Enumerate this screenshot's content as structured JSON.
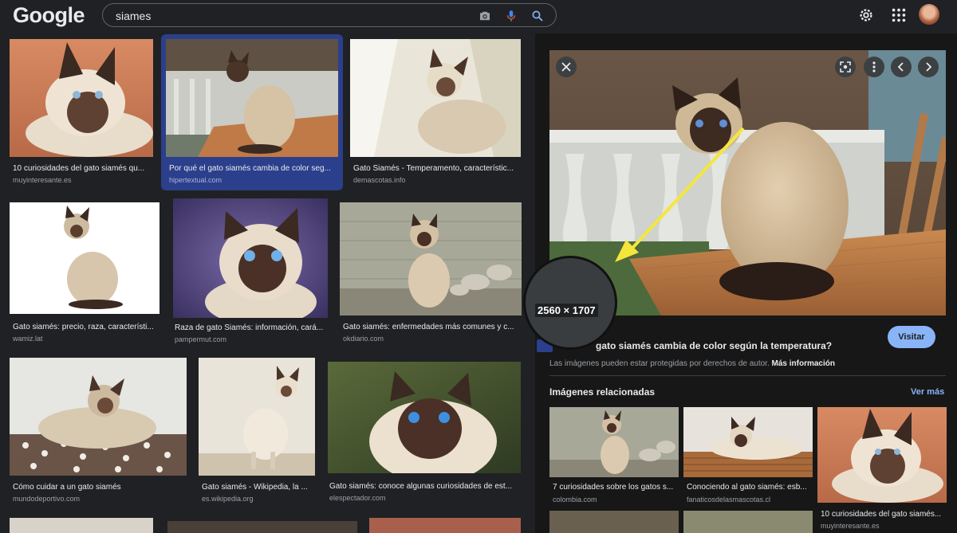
{
  "header": {
    "logo": "Google",
    "search_value": "siames",
    "icons": {
      "camera": "camera-icon",
      "mic": "mic-icon",
      "search": "search-icon",
      "settings": "gear-icon",
      "apps": "apps-grid-icon"
    },
    "accent": "#8ab4f8"
  },
  "results": [
    {
      "title": "10 curiosidades del gato siamés qu...",
      "source": "muyinteresante.es"
    },
    {
      "title": "Por qué el gato siamés cambia de color seg...",
      "source": "hipertextual.com"
    },
    {
      "title": "Gato Siamés - Temperamento, característic...",
      "source": "demascotas.info"
    },
    {
      "title": "Gato siamés: precio, raza, característi...",
      "source": "wamiz.lat"
    },
    {
      "title": "Raza de gato Siamés: información, cará...",
      "source": "pampermut.com"
    },
    {
      "title": "Gato siamés: enfermedades más comunes y c...",
      "source": "okdiario.com"
    },
    {
      "title": "Cómo cuidar a un gato siamés",
      "source": "mundodeportivo.com"
    },
    {
      "title": "Gato siamés - Wikipedia, la ...",
      "source": "es.wikipedia.org"
    },
    {
      "title": "Gato siamés: conoce algunas curiosidades de est...",
      "source": "elespectador.com"
    }
  ],
  "panel": {
    "dimensions": "2560 × 1707",
    "title": "gato siamés cambia de color según la temperatura?",
    "visit_label": "Visitar",
    "copyright_note": "Las imágenes pueden estar protegidas por derechos de autor.",
    "more_info": "Más información",
    "related_heading": "Imágenes relacionadas",
    "see_more": "Ver más",
    "related": [
      {
        "title": "7 curiosidades sobre los gatos s...",
        "source": "colombia.com"
      },
      {
        "title": "Conociendo al gato siamés: esb...",
        "source": "fanaticosdelasmascotas.cl"
      },
      {
        "title": "10 curiosidades del gato siamés...",
        "source": "muyinteresante.es"
      }
    ]
  }
}
